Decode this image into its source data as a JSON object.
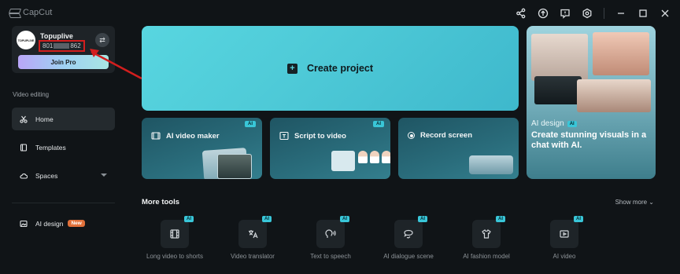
{
  "app": {
    "title": "CapCut"
  },
  "titlebar": {
    "icons": [
      "share-icon",
      "upload-icon",
      "feedback-icon",
      "settings-icon",
      "minimize-icon",
      "maximize-icon",
      "close-icon"
    ]
  },
  "profile": {
    "avatar_text": "TOPUPLIVE",
    "name": "Topuplive",
    "id_prefix": "801",
    "id_suffix": "862",
    "join_label": "Join Pro"
  },
  "sidebar": {
    "section_label": "Video editing",
    "items": [
      {
        "label": "Home",
        "icon": "scissors-icon"
      },
      {
        "label": "Templates",
        "icon": "templates-icon"
      },
      {
        "label": "Spaces",
        "icon": "cloud-icon"
      }
    ],
    "ai_design": {
      "label": "AI design",
      "badge": "New",
      "icon": "ai-image-icon"
    }
  },
  "main": {
    "create_label": "Create project",
    "tools": [
      {
        "label": "AI video maker",
        "badge": "AI"
      },
      {
        "label": "Script to video",
        "badge": "AI"
      },
      {
        "label": "Record screen"
      }
    ],
    "ai_design_card": {
      "label": "AI design",
      "badge": "AI",
      "headline": "Create stunning visuals in a chat with AI."
    }
  },
  "more_tools": {
    "title": "More tools",
    "show_more": "Show more",
    "items": [
      {
        "label": "Long video to shorts",
        "badge": "AI",
        "icon": "film-icon"
      },
      {
        "label": "Video translator",
        "badge": "AI",
        "icon": "translate-icon"
      },
      {
        "label": "Text to speech",
        "badge": "AI",
        "icon": "speech-icon"
      },
      {
        "label": "AI dialogue scene",
        "badge": "AI",
        "icon": "dialogue-icon"
      },
      {
        "label": "AI fashion model",
        "badge": "AI",
        "icon": "shirt-icon"
      },
      {
        "label": "AI video",
        "badge": "AI",
        "icon": "ai-video-icon"
      }
    ]
  },
  "colors": {
    "accent": "#4fcbd8",
    "annotation": "#d21e1e",
    "background": "#101417"
  }
}
